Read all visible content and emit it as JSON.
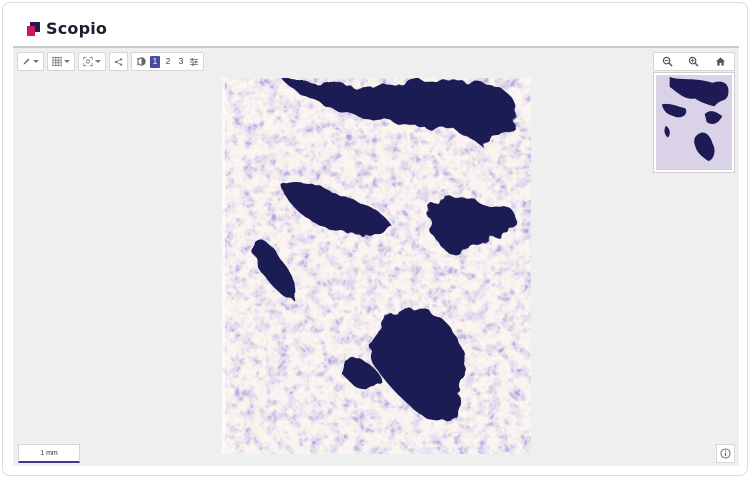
{
  "app": {
    "name": "Scopio"
  },
  "toolbar": {
    "annotate_tool": "pencil-icon",
    "grid_tool": "grid-icon",
    "focus_tool": "focus-icon",
    "share_tool": "share-icon",
    "layers_tool": "layers-icon",
    "pages": [
      "1",
      "2",
      "3"
    ],
    "active_page": "1",
    "settings_tool": "sliders-icon"
  },
  "zoom": {
    "out": "zoom-out-icon",
    "in": "zoom-in-icon",
    "home": "home-icon"
  },
  "scale": {
    "label": "1 mm"
  },
  "colors": {
    "accent": "#4a4a9e",
    "brand_dark": "#1d1d4f",
    "brand_pink": "#d0165f",
    "stain": "#1e1a55",
    "background": "#efefef"
  }
}
